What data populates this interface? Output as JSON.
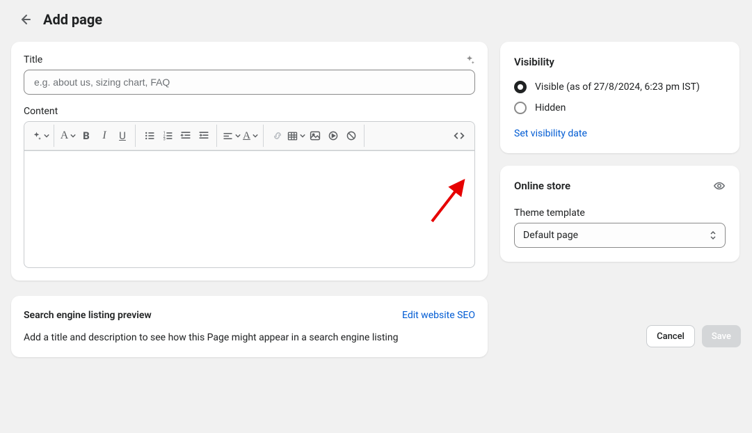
{
  "header": {
    "title": "Add page"
  },
  "main_card": {
    "title_label": "Title",
    "title_placeholder": "e.g. about us, sizing chart, FAQ",
    "content_label": "Content"
  },
  "seo": {
    "title": "Search engine listing preview",
    "edit_link": "Edit website SEO",
    "description": "Add a title and description to see how this Page might appear in a search engine listing"
  },
  "visibility": {
    "title": "Visibility",
    "visible_label": "Visible (as of 27/8/2024, 6:23 pm IST)",
    "hidden_label": "Hidden",
    "set_date_link": "Set visibility date"
  },
  "online_store": {
    "title": "Online store",
    "template_label": "Theme template",
    "template_value": "Default page"
  },
  "footer": {
    "cancel": "Cancel",
    "save": "Save"
  }
}
